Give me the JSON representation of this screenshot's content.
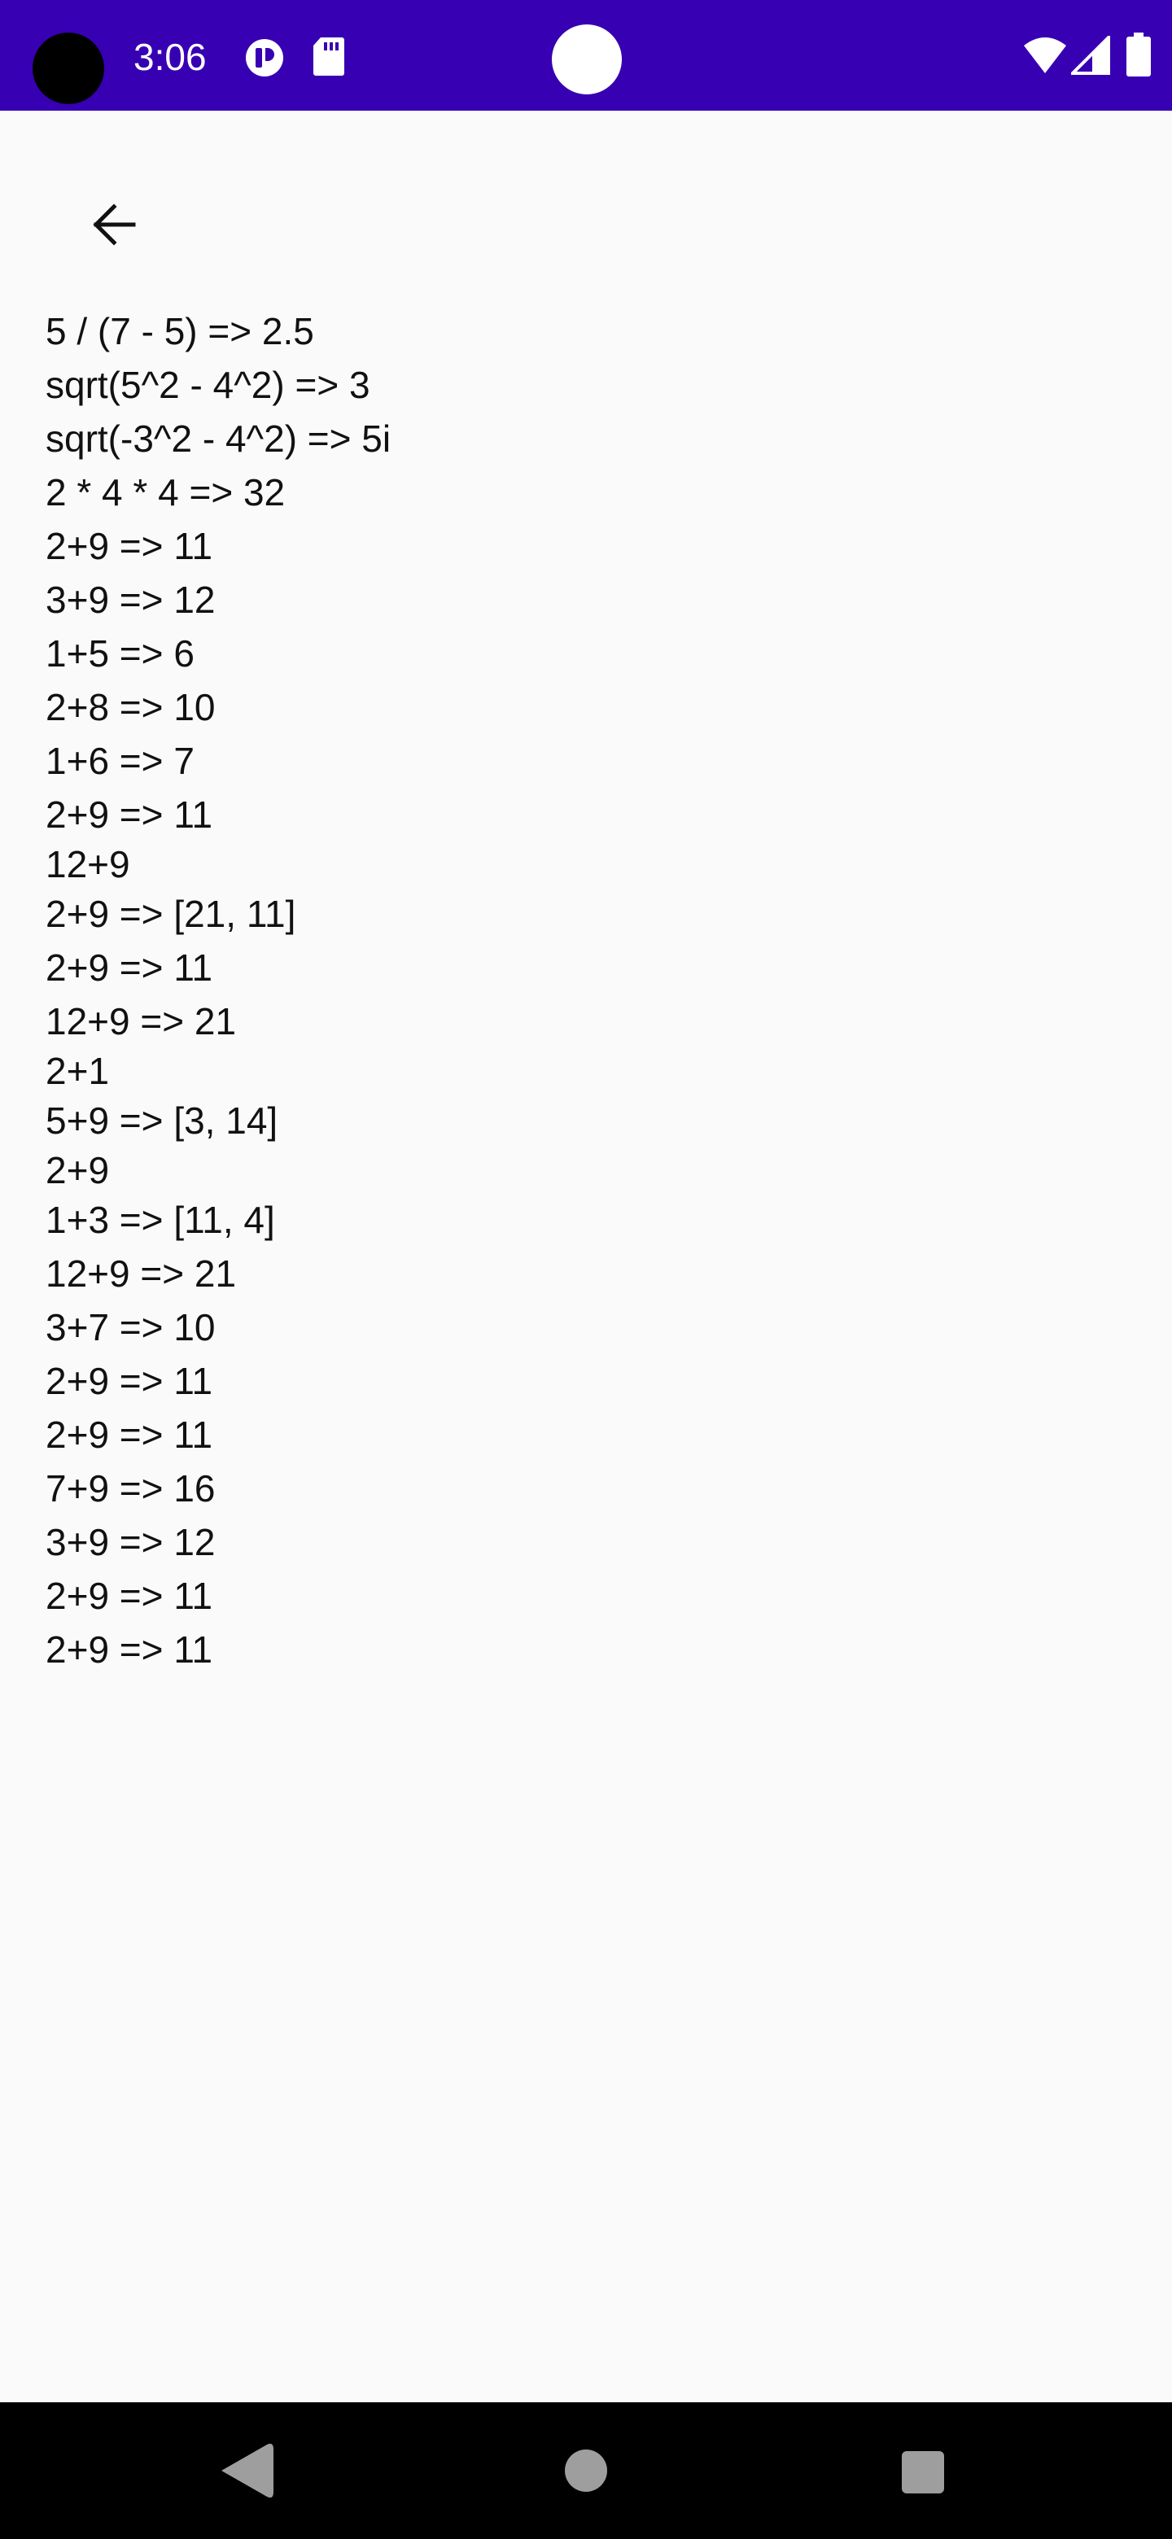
{
  "status_bar": {
    "time": "3:06",
    "background": "#3700B3",
    "icons": [
      "camera-cutout",
      "a-icon",
      "sd-card-icon",
      "center-dot",
      "wifi-icon",
      "signal-icon",
      "battery-icon"
    ]
  },
  "toolbar": {
    "back_icon": "arrow-back-icon"
  },
  "results": [
    {
      "text": "5 / (7 - 5) => 2.5",
      "height": 66
    },
    {
      "text": "sqrt(5^2 - 4^2) => 3",
      "height": 66
    },
    {
      "text": "sqrt(-3^2 - 4^2) => 5i",
      "height": 66
    },
    {
      "text": "2 * 4 * 4 => 32",
      "height": 66
    },
    {
      "text": "2+9 => 11",
      "height": 66
    },
    {
      "text": "3+9 => 12",
      "height": 66
    },
    {
      "text": "1+5 => 6",
      "height": 66
    },
    {
      "text": "2+8 => 10",
      "height": 66
    },
    {
      "text": "1+6 => 7",
      "height": 66
    },
    {
      "text": "2+9 => 11",
      "height": 66
    },
    {
      "text": "12+9",
      "height": 56
    },
    {
      "text": "2+9 => [21, 11]",
      "height": 66
    },
    {
      "text": "2+9 => 11",
      "height": 66
    },
    {
      "text": "12+9 => 21",
      "height": 66
    },
    {
      "text": "2+1",
      "height": 56
    },
    {
      "text": "5+9 => [3, 14]",
      "height": 66
    },
    {
      "text": "2+9",
      "height": 56
    },
    {
      "text": "1+3 => [11, 4]",
      "height": 66
    },
    {
      "text": "12+9 => 21",
      "height": 66
    },
    {
      "text": "3+7 => 10",
      "height": 66
    },
    {
      "text": "2+9 => 11",
      "height": 66
    },
    {
      "text": "2+9 => 11",
      "height": 66
    },
    {
      "text": "7+9 => 16",
      "height": 66
    },
    {
      "text": "3+9 => 12",
      "height": 66
    },
    {
      "text": "2+9 => 11",
      "height": 66
    },
    {
      "text": "2+9 => 11",
      "height": 66
    }
  ],
  "nav_bar": {
    "icons": [
      "nav-back-icon",
      "nav-home-icon",
      "nav-recents-icon"
    ]
  }
}
